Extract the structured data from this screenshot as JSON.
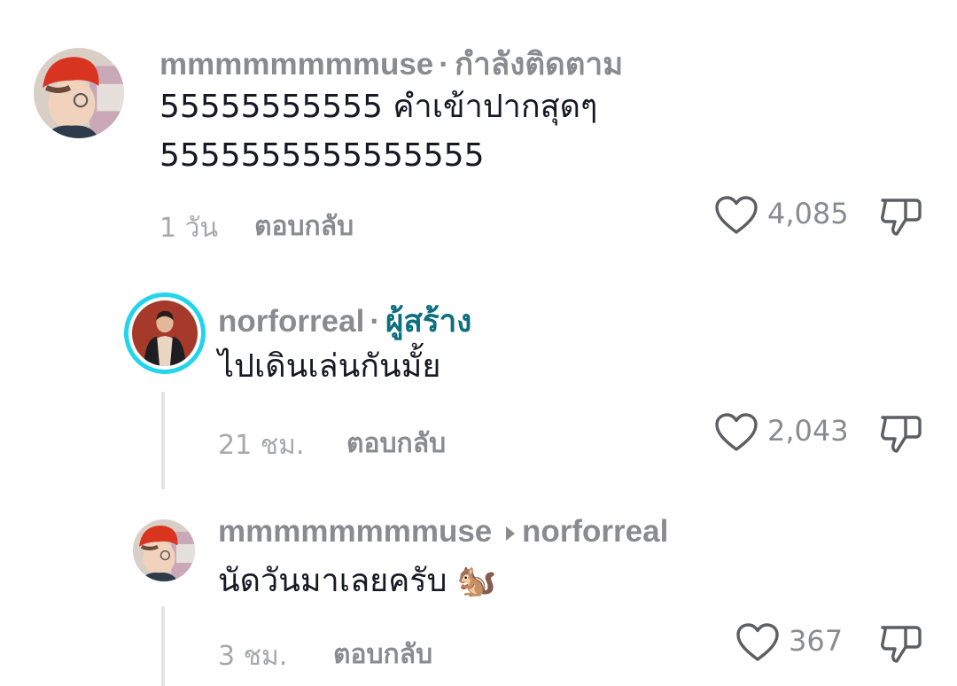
{
  "comments": [
    {
      "username": "mmmmmmmmuse",
      "following": "กำลังติดตาม",
      "text_line1": "55555555555 คำเข้าปากสุดๆ",
      "text_line2": "5555555555555555",
      "time": "1 วัน",
      "reply_label": "ตอบกลับ",
      "likes": "4,085"
    },
    {
      "username": "norforreal",
      "creator_badge": "ผู้สร้าง",
      "text": "ไปเดินเล่นกันมั้ย",
      "time": "21 ชม.",
      "reply_label": "ตอบกลับ",
      "likes": "2,043"
    },
    {
      "username": "mmmmmmmmuse",
      "reply_to": "norforreal",
      "text": "นัดวันมาเลยครับ 🐿️",
      "time": "3 ชม.",
      "reply_label": "ตอบกลับ",
      "likes": "367"
    }
  ],
  "icons": {
    "like": "heart-outline-icon",
    "dislike": "thumbs-down-outline-icon",
    "reply_arrow": "caret-right-icon"
  },
  "colors": {
    "username": "#8a8b91",
    "creator_badge": "#0b6f7e",
    "creator_ring": "#20d5ec",
    "text": "#161823",
    "meta": "#a7a8ac"
  }
}
